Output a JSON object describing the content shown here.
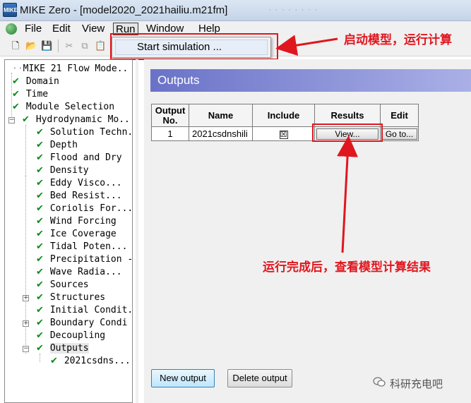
{
  "window": {
    "title": "MIKE Zero - [model2020_2021hailiu.m21fm]",
    "faded_title": "· · · · · · · ·",
    "icon_text": "MIKE"
  },
  "menu": {
    "items": [
      "File",
      "Edit",
      "View",
      "Run",
      "Window",
      "Help"
    ],
    "active": "Run"
  },
  "dropdown": {
    "items": [
      "Start simulation ..."
    ]
  },
  "tree": {
    "root": "MIKE 21 Flow Mode..",
    "items": [
      {
        "label": "Domain",
        "checked": true
      },
      {
        "label": "Time",
        "checked": true
      },
      {
        "label": "Module Selection",
        "checked": true
      },
      {
        "label": "Hydrodynamic Mo..",
        "checked": true
      },
      {
        "label": "Solution Techn.",
        "checked": true
      },
      {
        "label": "Depth",
        "checked": true
      },
      {
        "label": "Flood and Dry",
        "checked": true
      },
      {
        "label": "Density",
        "checked": true
      },
      {
        "label": "Eddy Visco...",
        "checked": true
      },
      {
        "label": "Bed Resist...",
        "checked": true
      },
      {
        "label": "Coriolis For...",
        "checked": true
      },
      {
        "label": "Wind Forcing",
        "checked": true
      },
      {
        "label": "Ice Coverage",
        "checked": true
      },
      {
        "label": "Tidal Poten...",
        "checked": true
      },
      {
        "label": "Precipitation -",
        "checked": true
      },
      {
        "label": "Wave Radia...",
        "checked": true
      },
      {
        "label": "Sources",
        "checked": true
      },
      {
        "label": "Structures",
        "checked": true
      },
      {
        "label": "Initial Condit.",
        "checked": true
      },
      {
        "label": "Boundary Condi",
        "checked": true
      },
      {
        "label": "Decoupling",
        "checked": true
      },
      {
        "label": "Outputs",
        "checked": true
      },
      {
        "label": "2021csdns...",
        "checked": true
      }
    ]
  },
  "main": {
    "header": "Outputs",
    "table": {
      "headers": [
        "Output No.",
        "Name",
        "Include",
        "Results",
        "Edit"
      ],
      "rows": [
        {
          "no": "1",
          "name": "2021csdnshili",
          "include": "☒",
          "results": "View...",
          "edit": "Go to..."
        }
      ]
    },
    "new_output": "New output",
    "delete_output": "Delete output"
  },
  "annotations": {
    "top": "启动模型，运行计算",
    "middle": "运行完成后，查看模型计算结果"
  },
  "watermark": "科研充电吧",
  "colors": {
    "annotation_red": "#e0161e",
    "header_gradient_start": "#6a72c8",
    "check_green": "#0a8a1a"
  }
}
